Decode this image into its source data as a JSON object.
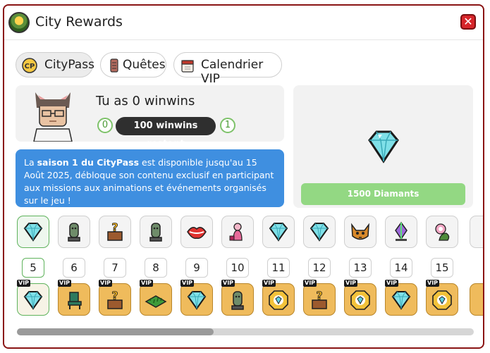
{
  "window": {
    "title": "City Rewards",
    "close": "✕"
  },
  "tabs": [
    {
      "label": "CityPass",
      "icon": "citypass-icon",
      "active": true
    },
    {
      "label": "Quêtes",
      "icon": "scroll-icon",
      "active": false
    },
    {
      "label": "Calendrier VIP",
      "icon": "calendar-icon",
      "active": false
    }
  ],
  "profile": {
    "winwins_text": "Tu as 0 winwins",
    "level_current": "0",
    "remaining": "100 winwins restant",
    "level_next": "1"
  },
  "info": {
    "prefix": "La ",
    "season": "saison 1 du CityPass",
    "rest": " est disponible jusqu'au 15 Août 2025, débloque son contenu exclusif en participant aux missions aux animations et événements organisés sur le jeu !"
  },
  "reward": {
    "label": "1500 Diamants",
    "icon": "diamond-icon"
  },
  "levels": [
    "5",
    "6",
    "7",
    "8",
    "9",
    "10",
    "11",
    "12",
    "13",
    "14",
    "15"
  ],
  "free_rewards": [
    "diamond-icon",
    "statue-icon",
    "mystery-box-icon",
    "statue-icon",
    "lips-icon",
    "pink-figure-icon",
    "diamond-icon",
    "diamond-icon",
    "cat-mask-icon",
    "crystal-icon",
    "flower-creature-icon"
  ],
  "vip_rewards": [
    "diamond-icon",
    "chair-icon",
    "mystery-box-icon",
    "grass-tile-icon",
    "diamond-icon",
    "statue-icon",
    "coin-icon",
    "mystery-box-icon",
    "coin-icon",
    "diamond-icon",
    "coin-icon"
  ],
  "vip_badge": "VIP",
  "scroll": {
    "position": 0.43
  },
  "colors": {
    "accent_border": "#8a1414",
    "info_blue": "#3f8fe0",
    "progress_green": "#93d883",
    "vip_gold": "#efbb5c"
  }
}
